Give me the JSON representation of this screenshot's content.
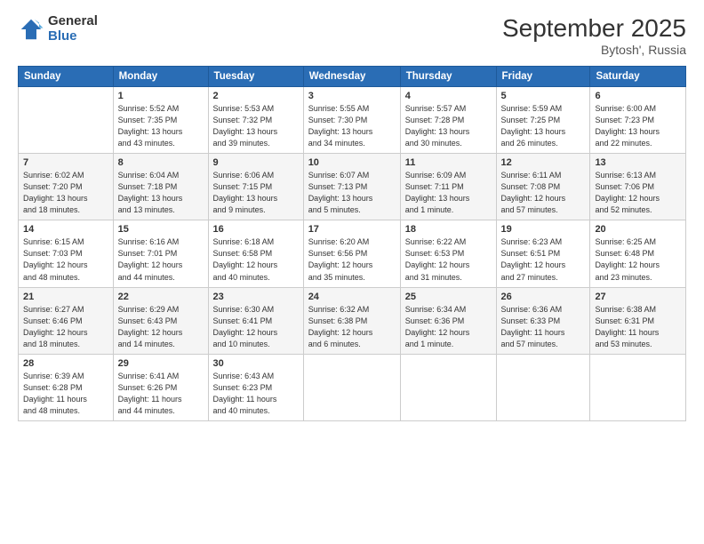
{
  "logo": {
    "general": "General",
    "blue": "Blue"
  },
  "header": {
    "month": "September 2025",
    "location": "Bytosh', Russia"
  },
  "weekdays": [
    "Sunday",
    "Monday",
    "Tuesday",
    "Wednesday",
    "Thursday",
    "Friday",
    "Saturday"
  ],
  "weeks": [
    [
      {
        "day": "",
        "info": ""
      },
      {
        "day": "1",
        "info": "Sunrise: 5:52 AM\nSunset: 7:35 PM\nDaylight: 13 hours\nand 43 minutes."
      },
      {
        "day": "2",
        "info": "Sunrise: 5:53 AM\nSunset: 7:32 PM\nDaylight: 13 hours\nand 39 minutes."
      },
      {
        "day": "3",
        "info": "Sunrise: 5:55 AM\nSunset: 7:30 PM\nDaylight: 13 hours\nand 34 minutes."
      },
      {
        "day": "4",
        "info": "Sunrise: 5:57 AM\nSunset: 7:28 PM\nDaylight: 13 hours\nand 30 minutes."
      },
      {
        "day": "5",
        "info": "Sunrise: 5:59 AM\nSunset: 7:25 PM\nDaylight: 13 hours\nand 26 minutes."
      },
      {
        "day": "6",
        "info": "Sunrise: 6:00 AM\nSunset: 7:23 PM\nDaylight: 13 hours\nand 22 minutes."
      }
    ],
    [
      {
        "day": "7",
        "info": "Sunrise: 6:02 AM\nSunset: 7:20 PM\nDaylight: 13 hours\nand 18 minutes."
      },
      {
        "day": "8",
        "info": "Sunrise: 6:04 AM\nSunset: 7:18 PM\nDaylight: 13 hours\nand 13 minutes."
      },
      {
        "day": "9",
        "info": "Sunrise: 6:06 AM\nSunset: 7:15 PM\nDaylight: 13 hours\nand 9 minutes."
      },
      {
        "day": "10",
        "info": "Sunrise: 6:07 AM\nSunset: 7:13 PM\nDaylight: 13 hours\nand 5 minutes."
      },
      {
        "day": "11",
        "info": "Sunrise: 6:09 AM\nSunset: 7:11 PM\nDaylight: 13 hours\nand 1 minute."
      },
      {
        "day": "12",
        "info": "Sunrise: 6:11 AM\nSunset: 7:08 PM\nDaylight: 12 hours\nand 57 minutes."
      },
      {
        "day": "13",
        "info": "Sunrise: 6:13 AM\nSunset: 7:06 PM\nDaylight: 12 hours\nand 52 minutes."
      }
    ],
    [
      {
        "day": "14",
        "info": "Sunrise: 6:15 AM\nSunset: 7:03 PM\nDaylight: 12 hours\nand 48 minutes."
      },
      {
        "day": "15",
        "info": "Sunrise: 6:16 AM\nSunset: 7:01 PM\nDaylight: 12 hours\nand 44 minutes."
      },
      {
        "day": "16",
        "info": "Sunrise: 6:18 AM\nSunset: 6:58 PM\nDaylight: 12 hours\nand 40 minutes."
      },
      {
        "day": "17",
        "info": "Sunrise: 6:20 AM\nSunset: 6:56 PM\nDaylight: 12 hours\nand 35 minutes."
      },
      {
        "day": "18",
        "info": "Sunrise: 6:22 AM\nSunset: 6:53 PM\nDaylight: 12 hours\nand 31 minutes."
      },
      {
        "day": "19",
        "info": "Sunrise: 6:23 AM\nSunset: 6:51 PM\nDaylight: 12 hours\nand 27 minutes."
      },
      {
        "day": "20",
        "info": "Sunrise: 6:25 AM\nSunset: 6:48 PM\nDaylight: 12 hours\nand 23 minutes."
      }
    ],
    [
      {
        "day": "21",
        "info": "Sunrise: 6:27 AM\nSunset: 6:46 PM\nDaylight: 12 hours\nand 18 minutes."
      },
      {
        "day": "22",
        "info": "Sunrise: 6:29 AM\nSunset: 6:43 PM\nDaylight: 12 hours\nand 14 minutes."
      },
      {
        "day": "23",
        "info": "Sunrise: 6:30 AM\nSunset: 6:41 PM\nDaylight: 12 hours\nand 10 minutes."
      },
      {
        "day": "24",
        "info": "Sunrise: 6:32 AM\nSunset: 6:38 PM\nDaylight: 12 hours\nand 6 minutes."
      },
      {
        "day": "25",
        "info": "Sunrise: 6:34 AM\nSunset: 6:36 PM\nDaylight: 12 hours\nand 1 minute."
      },
      {
        "day": "26",
        "info": "Sunrise: 6:36 AM\nSunset: 6:33 PM\nDaylight: 11 hours\nand 57 minutes."
      },
      {
        "day": "27",
        "info": "Sunrise: 6:38 AM\nSunset: 6:31 PM\nDaylight: 11 hours\nand 53 minutes."
      }
    ],
    [
      {
        "day": "28",
        "info": "Sunrise: 6:39 AM\nSunset: 6:28 PM\nDaylight: 11 hours\nand 48 minutes."
      },
      {
        "day": "29",
        "info": "Sunrise: 6:41 AM\nSunset: 6:26 PM\nDaylight: 11 hours\nand 44 minutes."
      },
      {
        "day": "30",
        "info": "Sunrise: 6:43 AM\nSunset: 6:23 PM\nDaylight: 11 hours\nand 40 minutes."
      },
      {
        "day": "",
        "info": ""
      },
      {
        "day": "",
        "info": ""
      },
      {
        "day": "",
        "info": ""
      },
      {
        "day": "",
        "info": ""
      }
    ]
  ]
}
